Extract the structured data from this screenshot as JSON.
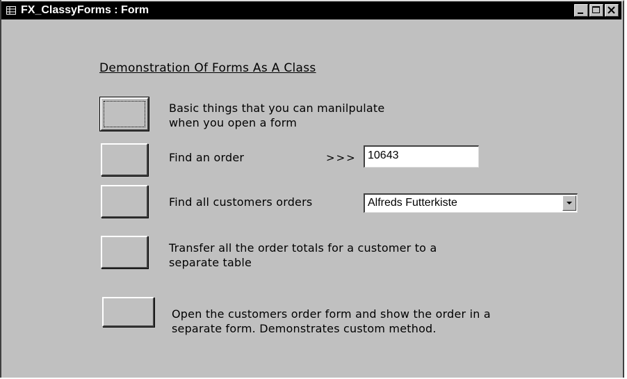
{
  "window": {
    "title": "FX_ClassyForms : Form",
    "title_icon": "form-icon",
    "controls": [
      "minimize-icon",
      "maximize-icon",
      "close-icon"
    ]
  },
  "form": {
    "heading": "Demonstration Of Forms As A Class",
    "rows": [
      {
        "label_line1": "Basic things that you can manilpulate",
        "label_line2": "when you open a form"
      },
      {
        "label_line1": "Find an order"
      },
      {
        "label_line1": "Find all customers orders"
      },
      {
        "label_line1": "Transfer all the order totals for a customer to a",
        "label_line2": "separate table"
      },
      {
        "label_line1": "Open the customers order form and show the order in a",
        "label_line2": "separate form.  Demonstrates custom method."
      }
    ],
    "order_arrows": ">>>",
    "order_value": "10643",
    "customer_value": "Alfreds Futterkiste",
    "dropdown_icon": "chevron-down-icon"
  },
  "colors": {
    "face": "#c0c0c0",
    "titlebar": "#000000",
    "title_text": "#ffffff"
  }
}
